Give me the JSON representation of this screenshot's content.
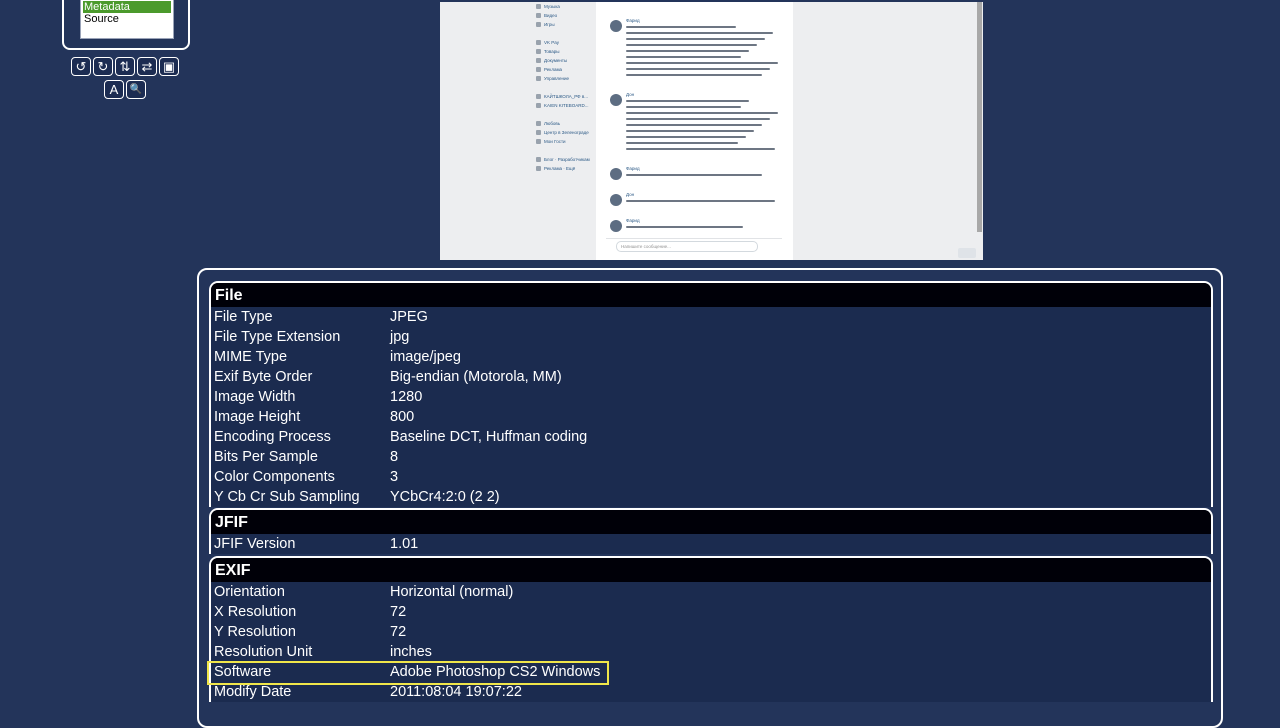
{
  "menu": {
    "items": [
      "Metadata",
      "Source"
    ],
    "selected": "Metadata"
  },
  "toolbar": {
    "rotate_left": "↺",
    "rotate_right": "↻",
    "flip_vertical": "⇅",
    "flip_horizontal": "⇄",
    "frame": "▣",
    "text": "A",
    "zoom": "🔍"
  },
  "preview": {
    "sidebar_items": [
      "Музыка",
      "Видео",
      "Игры",
      "",
      "VK Pay",
      "Товары",
      "Документы",
      "Реклама",
      "Управление",
      "",
      "КАЙТШКОЛА_РФ в...",
      "KAIEN KITEBOARD...",
      "",
      "Любовь",
      "Центр в Зеленоградe",
      "Мои Гости",
      "",
      "Блог · Разработчикам",
      "Реклама · Ещё"
    ],
    "messages": [
      {
        "name": "Фарид",
        "lines": 9
      },
      {
        "name": "Дон",
        "lines": 9
      },
      {
        "name": "Фарид",
        "lines": 1
      },
      {
        "name": "Дон",
        "lines": 1
      },
      {
        "name": "Фарид",
        "lines": 1
      }
    ],
    "input_placeholder": "Напишите сообщение..."
  },
  "sections": [
    {
      "title": "File",
      "rows": [
        {
          "key": "File Type",
          "value": "JPEG"
        },
        {
          "key": "File Type Extension",
          "value": "jpg"
        },
        {
          "key": "MIME Type",
          "value": "image/jpeg"
        },
        {
          "key": "Exif Byte Order",
          "value": "Big-endian (Motorola, MM)"
        },
        {
          "key": "Image Width",
          "value": "1280"
        },
        {
          "key": "Image Height",
          "value": "800"
        },
        {
          "key": "Encoding Process",
          "value": "Baseline DCT, Huffman coding"
        },
        {
          "key": "Bits Per Sample",
          "value": "8"
        },
        {
          "key": "Color Components",
          "value": "3"
        },
        {
          "key": "Y Cb Cr Sub Sampling",
          "value": "YCbCr4:2:0 (2 2)"
        }
      ]
    },
    {
      "title": "JFIF",
      "rows": [
        {
          "key": "JFIF Version",
          "value": "1.01"
        }
      ]
    },
    {
      "title": "EXIF",
      "rows": [
        {
          "key": "Orientation",
          "value": "Horizontal (normal)"
        },
        {
          "key": "X Resolution",
          "value": "72"
        },
        {
          "key": "Y Resolution",
          "value": "72"
        },
        {
          "key": "Resolution Unit",
          "value": "inches"
        },
        {
          "key": "Software",
          "value": "Adobe Photoshop CS2 Windows",
          "highlight": true
        },
        {
          "key": "Modify Date",
          "value": "2011:08:04 19:07:22"
        }
      ]
    }
  ],
  "colors": {
    "background": "#23345a",
    "header": "#000008",
    "selected": "#4b9a2c",
    "highlight": "#f0e64a"
  }
}
